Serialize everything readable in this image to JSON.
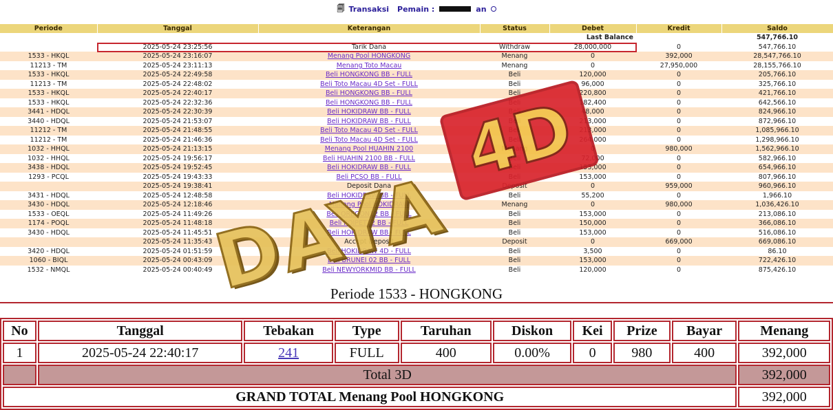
{
  "header": {
    "transaksi_label": "Transaksi",
    "pemain_label": "Pemain :",
    "pemain_suffix": "an"
  },
  "columns": [
    "Periode",
    "Tanggal",
    "Keterangan",
    "Status",
    "Debet",
    "Kredit",
    "Saldo"
  ],
  "last_balance": {
    "label": "Last Balance",
    "value": "547,766.10"
  },
  "rows": [
    {
      "periode": "",
      "tanggal": "2025-05-24 23:25:56",
      "keterangan": "Tarik Dana",
      "link": false,
      "status": "Withdraw",
      "debet": "28,000,000",
      "kredit": "0",
      "saldo": "547,766.10"
    },
    {
      "periode": "1533 - HKQL",
      "tanggal": "2025-05-24 23:16:07",
      "keterangan": "Menang Pool HONGKONG",
      "link": true,
      "status": "Menang",
      "debet": "0",
      "kredit": "392,000",
      "saldo": "28,547,766.10"
    },
    {
      "periode": "11213 - TM",
      "tanggal": "2025-05-24 23:11:13",
      "keterangan": "Menang Toto Macau",
      "link": true,
      "status": "Menang",
      "debet": "0",
      "kredit": "27,950,000",
      "saldo": "28,155,766.10"
    },
    {
      "periode": "1533 - HKQL",
      "tanggal": "2025-05-24 22:49:58",
      "keterangan": "Beli HONGKONG BB - FULL",
      "link": true,
      "status": "Beli",
      "debet": "120,000",
      "kredit": "0",
      "saldo": "205,766.10"
    },
    {
      "periode": "11213 - TM",
      "tanggal": "2025-05-24 22:48:02",
      "keterangan": "Beli Toto Macau 4D Set - FULL",
      "link": true,
      "status": "Beli",
      "debet": "96,000",
      "kredit": "0",
      "saldo": "325,766.10"
    },
    {
      "periode": "1533 - HKQL",
      "tanggal": "2025-05-24 22:40:17",
      "keterangan": "Beli HONGKONG BB - FULL",
      "link": true,
      "status": "Beli",
      "debet": "220,800",
      "kredit": "0",
      "saldo": "421,766.10"
    },
    {
      "periode": "1533 - HKQL",
      "tanggal": "2025-05-24 22:32:36",
      "keterangan": "Beli HONGKONG BB - FULL",
      "link": true,
      "status": "Beli",
      "debet": "182,400",
      "kredit": "0",
      "saldo": "642,566.10"
    },
    {
      "periode": "3441 - HDQL",
      "tanggal": "2025-05-24 22:30:39",
      "keterangan": "Beli HOKIDRAW BB - FULL",
      "link": true,
      "status": "Beli",
      "debet": "48,000",
      "kredit": "0",
      "saldo": "824,966.10"
    },
    {
      "periode": "3440 - HDQL",
      "tanggal": "2025-05-24 21:53:07",
      "keterangan": "Beli HOKIDRAW BB - FULL",
      "link": true,
      "status": "Beli",
      "debet": "213,000",
      "kredit": "0",
      "saldo": "872,966.10"
    },
    {
      "periode": "11212 - TM",
      "tanggal": "2025-05-24 21:48:55",
      "keterangan": "Beli Toto Macau 4D Set - FULL",
      "link": true,
      "status": "Beli",
      "debet": "213,000",
      "kredit": "0",
      "saldo": "1,085,966.10"
    },
    {
      "periode": "11212 - TM",
      "tanggal": "2025-05-24 21:46:36",
      "keterangan": "Beli Toto Macau 4D Set - FULL",
      "link": true,
      "status": "Beli",
      "debet": "264,000",
      "kredit": "0",
      "saldo": "1,298,966.10"
    },
    {
      "periode": "1032 - HHQL",
      "tanggal": "2025-05-24 21:13:15",
      "keterangan": "Menang Pool HUAHIN 2100",
      "link": true,
      "status": "Menang",
      "debet": "0",
      "kredit": "980,000",
      "saldo": "1,562,966.10"
    },
    {
      "periode": "1032 - HHQL",
      "tanggal": "2025-05-24 19:56:17",
      "keterangan": "Beli HUAHIN 2100 BB - FULL",
      "link": true,
      "status": "Beli",
      "debet": "72,000",
      "kredit": "0",
      "saldo": "582,966.10"
    },
    {
      "periode": "3438 - HDQL",
      "tanggal": "2025-05-24 19:52:45",
      "keterangan": "Beli HOKIDRAW BB - FULL",
      "link": true,
      "status": "Beli",
      "debet": "153,000",
      "kredit": "0",
      "saldo": "654,966.10"
    },
    {
      "periode": "1293 - PCQL",
      "tanggal": "2025-05-24 19:43:33",
      "keterangan": "Beli PCSO BB - FULL",
      "link": true,
      "status": "Beli",
      "debet": "153,000",
      "kredit": "0",
      "saldo": "807,966.10"
    },
    {
      "periode": "",
      "tanggal": "2025-05-24 19:38:41",
      "keterangan": "Deposit Dana",
      "link": false,
      "status": "Deposit",
      "debet": "0",
      "kredit": "959,000",
      "saldo": "960,966.10"
    },
    {
      "periode": "3431 - HDQL",
      "tanggal": "2025-05-24 12:48:58",
      "keterangan": "Beli HOKIDRAW BB - FULL",
      "link": true,
      "status": "Beli",
      "debet": "55,200",
      "kredit": "0",
      "saldo": "1,966.10"
    },
    {
      "periode": "3430 - HDQL",
      "tanggal": "2025-05-24 12:18:46",
      "keterangan": "Menang Pool HOKIDRAW",
      "link": true,
      "status": "Menang",
      "debet": "0",
      "kredit": "980,000",
      "saldo": "1,036,426.10"
    },
    {
      "periode": "1533 - OEQL",
      "tanggal": "2025-05-24 11:49:26",
      "keterangan": "Beli OREGON12 BB - FULL",
      "link": true,
      "status": "Beli",
      "debet": "153,000",
      "kredit": "0",
      "saldo": "213,086.10"
    },
    {
      "periode": "1174 - POQL",
      "tanggal": "2025-05-24 11:48:18",
      "keterangan": "Beli POIPET12 BB - FULL",
      "link": true,
      "status": "Beli",
      "debet": "150,000",
      "kredit": "0",
      "saldo": "366,086.10"
    },
    {
      "periode": "3430 - HDQL",
      "tanggal": "2025-05-24 11:45:51",
      "keterangan": "Beli HOKIDRAW BB - FULL",
      "link": true,
      "status": "Beli",
      "debet": "153,000",
      "kredit": "0",
      "saldo": "516,086.10"
    },
    {
      "periode": "",
      "tanggal": "2025-05-24 11:35:43",
      "keterangan": "Accept Deposit",
      "link": false,
      "status": "Deposit",
      "debet": "0",
      "kredit": "669,000",
      "saldo": "669,086.10"
    },
    {
      "periode": "3420 - HDQL",
      "tanggal": "2025-05-24 01:51:59",
      "keterangan": "Beli HOKIDRAW 4D - FULL",
      "link": true,
      "status": "Beli",
      "debet": "3,500",
      "kredit": "0",
      "saldo": "86.10"
    },
    {
      "periode": "1060 - BIQL",
      "tanggal": "2025-05-24 00:43:09",
      "keterangan": "Beli BRUNEI 02 BB - FULL",
      "link": true,
      "status": "Beli",
      "debet": "153,000",
      "kredit": "0",
      "saldo": "722,426.10"
    },
    {
      "periode": "1532 - NMQL",
      "tanggal": "2025-05-24 00:40:49",
      "keterangan": "Beli NEWYORKMID BB - FULL",
      "link": true,
      "status": "Beli",
      "debet": "120,000",
      "kredit": "0",
      "saldo": "875,426.10"
    }
  ],
  "watermark": {
    "word": "DAYA",
    "badge": "4D"
  },
  "detail": {
    "title": "Periode 1533 - HONGKONG",
    "columns": [
      "No",
      "Tanggal",
      "Tebakan",
      "Type",
      "Taruhan",
      "Diskon",
      "Kei",
      "Prize",
      "Bayar",
      "Menang"
    ],
    "row": {
      "no": "1",
      "tanggal": "2025-05-24 22:40:17",
      "tebakan": "241",
      "type": "FULL",
      "taruhan": "400",
      "diskon": "0.00%",
      "kei": "0",
      "prize": "980",
      "bayar": "400",
      "menang": "392,000"
    },
    "total_label": "Total 3D",
    "total_value": "392,000",
    "grand_total_label": "GRAND TOTAL  Menang Pool HONGKONG",
    "grand_total_value": "392,000"
  },
  "colors": {
    "header_bg": "#ecd67b",
    "alt_row": "#fde3c8",
    "accent_red": "#b3262e",
    "status_red": "#c02020",
    "kredit_blue": "#4848d8",
    "saldo_purple": "#5438c8"
  }
}
